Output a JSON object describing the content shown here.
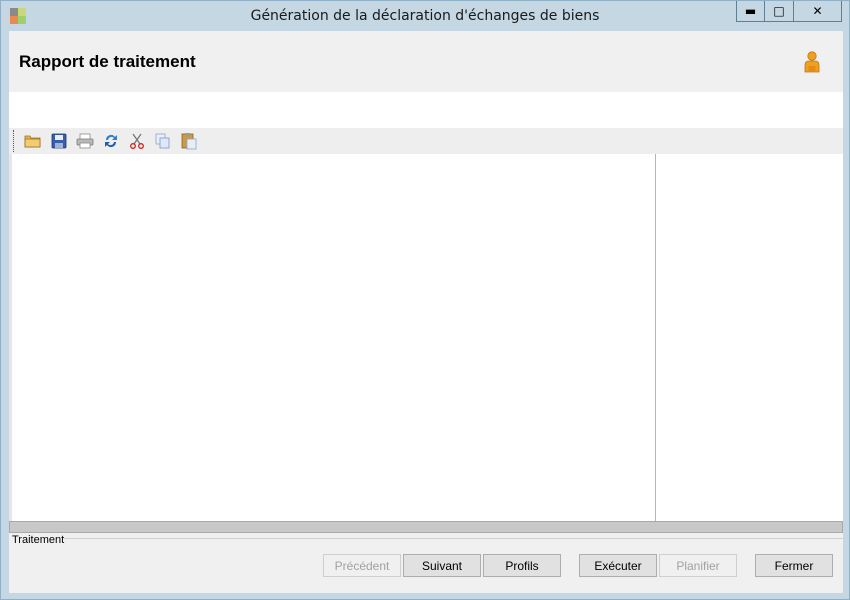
{
  "window": {
    "title": "Génération de la déclaration d'échanges de biens",
    "controls": {
      "minimize": "▬",
      "maximize": "□",
      "close": "✕"
    }
  },
  "header": {
    "title": "Rapport de traitement",
    "user_icon": "user-icon"
  },
  "toolbar": {
    "items": [
      {
        "name": "open-folder-icon"
      },
      {
        "name": "save-icon"
      },
      {
        "name": "print-icon"
      },
      {
        "name": "refresh-icon"
      },
      {
        "name": "cut-icon"
      },
      {
        "name": "copy-icon"
      },
      {
        "name": "paste-icon"
      }
    ]
  },
  "status": {
    "group_label": "Traitement"
  },
  "buttons": {
    "precedent": {
      "label": "Précédent",
      "enabled": false
    },
    "suivant": {
      "label": "Suivant",
      "enabled": true
    },
    "profils": {
      "label": "Profils",
      "enabled": true
    },
    "executer": {
      "label": "Exécuter",
      "enabled": true
    },
    "planifier": {
      "label": "Planifier",
      "enabled": false
    },
    "fermer": {
      "label": "Fermer",
      "enabled": true
    }
  },
  "colors": {
    "title_bar": "#c4d7e3",
    "client_bg": "#f0f0f0",
    "user_icon": "#f0a020"
  }
}
